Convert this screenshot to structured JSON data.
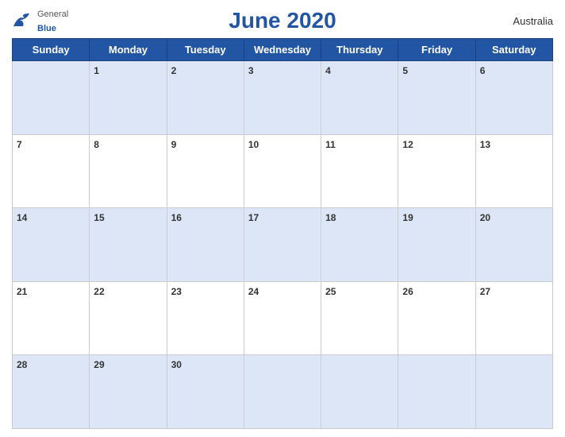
{
  "header": {
    "title": "June 2020",
    "country": "Australia",
    "logo": {
      "general": "General",
      "blue": "Blue"
    }
  },
  "days_of_week": [
    "Sunday",
    "Monday",
    "Tuesday",
    "Wednesday",
    "Thursday",
    "Friday",
    "Saturday"
  ],
  "weeks": [
    [
      null,
      1,
      2,
      3,
      4,
      5,
      6
    ],
    [
      7,
      8,
      9,
      10,
      11,
      12,
      13
    ],
    [
      14,
      15,
      16,
      17,
      18,
      19,
      20
    ],
    [
      21,
      22,
      23,
      24,
      25,
      26,
      27
    ],
    [
      28,
      29,
      30,
      null,
      null,
      null,
      null
    ]
  ]
}
